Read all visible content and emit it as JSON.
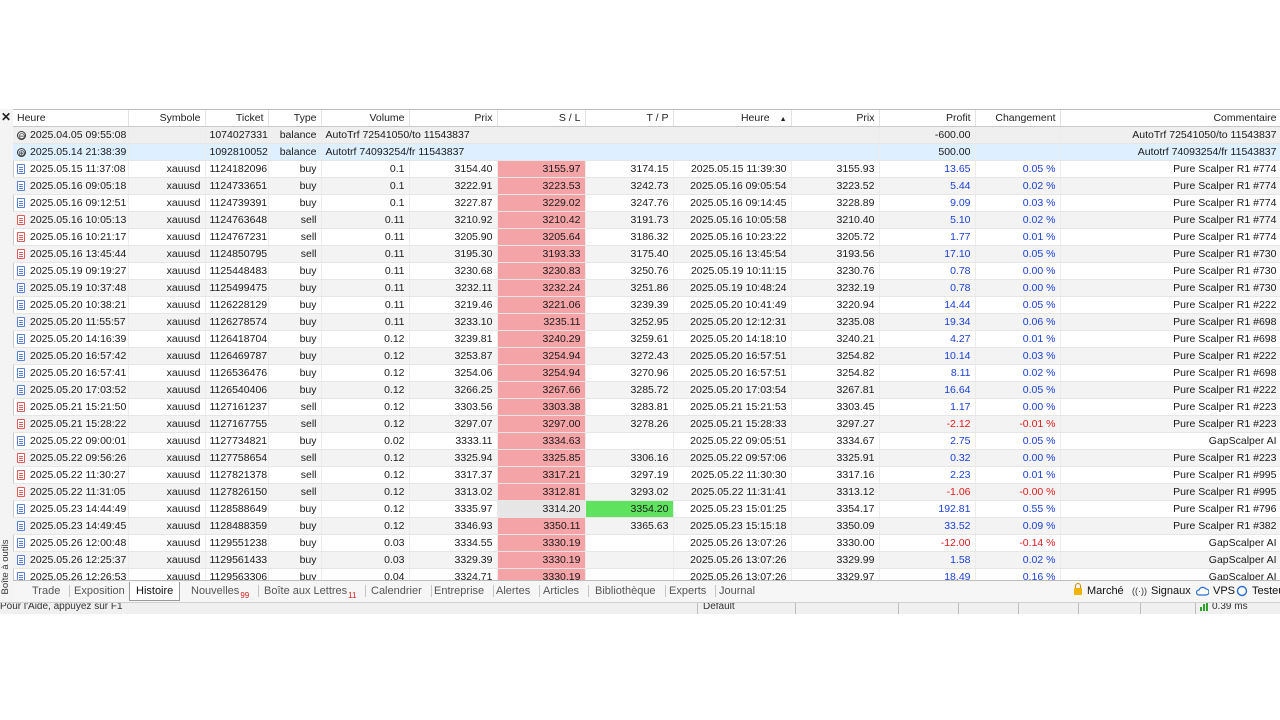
{
  "side_panel": {
    "close": "✕",
    "label": "Boîte à outils"
  },
  "columns": [
    "Heure",
    "Symbole",
    "Ticket",
    "Type",
    "Volume",
    "Prix",
    "S / L",
    "T / P",
    "Heure",
    "Prix",
    "Profit",
    "Changement",
    "Commentaire"
  ],
  "sort_indicator": "▲",
  "balance_rows": [
    {
      "time": "2025.04.05 09:55:08",
      "ticket": "1074027331",
      "type": "balance",
      "text": "AutoTrf 72541050/to 11543837",
      "profit": "-600.00",
      "comment": "AutoTrf 72541050/to 11543837",
      "sign": "⊖"
    },
    {
      "time": "2025.05.14 21:38:39",
      "ticket": "1092810052",
      "type": "balance",
      "text": "Autotrf 74093254/fr 11543837",
      "profit": "500.00",
      "comment": "Autotrf 74093254/fr 11543837",
      "sign": "⊕"
    }
  ],
  "trades": [
    {
      "t1": "2025.05.15 11:37:08",
      "sym": "xauusd",
      "ticket": "1124182096",
      "type": "buy",
      "vol": "0.1",
      "p1": "3154.40",
      "sl": "3155.97",
      "tp": "3174.15",
      "t2": "2025.05.15 11:39:30",
      "p2": "3155.93",
      "profit": "13.65",
      "chg": "0.05 %"
    },
    {
      "t1": "2025.05.16 09:05:18",
      "sym": "xauusd",
      "ticket": "1124733651",
      "type": "buy",
      "vol": "0.1",
      "p1": "3222.91",
      "sl": "3223.53",
      "tp": "3242.73",
      "t2": "2025.05.16 09:05:54",
      "p2": "3223.52",
      "profit": "5.44",
      "chg": "0.02 %"
    },
    {
      "t1": "2025.05.16 09:12:51",
      "sym": "xauusd",
      "ticket": "1124739391",
      "type": "buy",
      "vol": "0.1",
      "p1": "3227.87",
      "sl": "3229.02",
      "tp": "3247.76",
      "t2": "2025.05.16 09:14:45",
      "p2": "3228.89",
      "profit": "9.09",
      "chg": "0.03 %"
    },
    {
      "t1": "2025.05.16 10:05:13",
      "sym": "xauusd",
      "ticket": "1124763648",
      "type": "sell",
      "vol": "0.11",
      "p1": "3210.92",
      "sl": "3210.42",
      "tp": "3191.73",
      "t2": "2025.05.16 10:05:58",
      "p2": "3210.40",
      "profit": "5.10",
      "chg": "0.02 %"
    },
    {
      "t1": "2025.05.16 10:21:17",
      "sym": "xauusd",
      "ticket": "1124767231",
      "type": "sell",
      "vol": "0.11",
      "p1": "3205.90",
      "sl": "3205.64",
      "tp": "3186.32",
      "t2": "2025.05.16 10:23:22",
      "p2": "3205.72",
      "profit": "1.77",
      "chg": "0.01 %"
    },
    {
      "t1": "2025.05.16 13:45:44",
      "sym": "xauusd",
      "ticket": "1124850795",
      "type": "sell",
      "vol": "0.11",
      "p1": "3195.30",
      "sl": "3193.33",
      "tp": "3175.40",
      "t2": "2025.05.16 13:45:54",
      "p2": "3193.56",
      "profit": "17.10",
      "chg": "0.05 %"
    },
    {
      "t1": "2025.05.19 09:19:27",
      "sym": "xauusd",
      "ticket": "1125448483",
      "type": "buy",
      "vol": "0.11",
      "p1": "3230.68",
      "sl": "3230.83",
      "tp": "3250.76",
      "t2": "2025.05.19 10:11:15",
      "p2": "3230.76",
      "profit": "0.78",
      "chg": "0.00 %"
    },
    {
      "t1": "2025.05.19 10:37:48",
      "sym": "xauusd",
      "ticket": "1125499475",
      "type": "buy",
      "vol": "0.11",
      "p1": "3232.11",
      "sl": "3232.24",
      "tp": "3251.86",
      "t2": "2025.05.19 10:48:24",
      "p2": "3232.19",
      "profit": "0.78",
      "chg": "0.00 %"
    },
    {
      "t1": "2025.05.20 10:38:21",
      "sym": "xauusd",
      "ticket": "1126228129",
      "type": "buy",
      "vol": "0.11",
      "p1": "3219.46",
      "sl": "3221.06",
      "tp": "3239.39",
      "t2": "2025.05.20 10:41:49",
      "p2": "3220.94",
      "profit": "14.44",
      "chg": "0.05 %"
    },
    {
      "t1": "2025.05.20 11:55:57",
      "sym": "xauusd",
      "ticket": "1126278574",
      "type": "buy",
      "vol": "0.11",
      "p1": "3233.10",
      "sl": "3235.11",
      "tp": "3252.95",
      "t2": "2025.05.20 12:12:31",
      "p2": "3235.08",
      "profit": "19.34",
      "chg": "0.06 %"
    },
    {
      "t1": "2025.05.20 14:16:39",
      "sym": "xauusd",
      "ticket": "1126418704",
      "type": "buy",
      "vol": "0.12",
      "p1": "3239.81",
      "sl": "3240.29",
      "tp": "3259.61",
      "t2": "2025.05.20 14:18:10",
      "p2": "3240.21",
      "profit": "4.27",
      "chg": "0.01 %"
    },
    {
      "t1": "2025.05.20 16:57:42",
      "sym": "xauusd",
      "ticket": "1126469787",
      "type": "buy",
      "vol": "0.12",
      "p1": "3253.87",
      "sl": "3254.94",
      "tp": "3272.43",
      "t2": "2025.05.20 16:57:51",
      "p2": "3254.82",
      "profit": "10.14",
      "chg": "0.03 %"
    },
    {
      "t1": "2025.05.20 16:57:41",
      "sym": "xauusd",
      "ticket": "1126536476",
      "type": "buy",
      "vol": "0.12",
      "p1": "3254.06",
      "sl": "3254.94",
      "tp": "3270.96",
      "t2": "2025.05.20 16:57:51",
      "p2": "3254.82",
      "profit": "8.11",
      "chg": "0.02 %"
    },
    {
      "t1": "2025.05.20 17:03:52",
      "sym": "xauusd",
      "ticket": "1126540406",
      "type": "buy",
      "vol": "0.12",
      "p1": "3266.25",
      "sl": "3267.66",
      "tp": "3285.72",
      "t2": "2025.05.20 17:03:54",
      "p2": "3267.81",
      "profit": "16.64",
      "chg": "0.05 %"
    },
    {
      "t1": "2025.05.21 15:21:50",
      "sym": "xauusd",
      "ticket": "1127161237",
      "type": "sell",
      "vol": "0.12",
      "p1": "3303.56",
      "sl": "3303.38",
      "tp": "3283.81",
      "t2": "2025.05.21 15:21:53",
      "p2": "3303.45",
      "profit": "1.17",
      "chg": "0.00 %"
    },
    {
      "t1": "2025.05.21 15:28:22",
      "sym": "xauusd",
      "ticket": "1127167755",
      "type": "sell",
      "vol": "0.12",
      "p1": "3297.07",
      "sl": "3297.00",
      "tp": "3278.26",
      "t2": "2025.05.21 15:28:33",
      "p2": "3297.27",
      "profit": "-2.12",
      "chg": "-0.01 %"
    },
    {
      "t1": "2025.05.22 09:00:01",
      "sym": "xauusd",
      "ticket": "1127734821",
      "type": "buy",
      "vol": "0.02",
      "p1": "3333.11",
      "sl": "3334.63",
      "tp": "",
      "t2": "2025.05.22 09:05:51",
      "p2": "3334.67",
      "profit": "2.75",
      "chg": "0.05 %"
    },
    {
      "t1": "2025.05.22 09:56:26",
      "sym": "xauusd",
      "ticket": "1127758654",
      "type": "sell",
      "vol": "0.12",
      "p1": "3325.94",
      "sl": "3325.85",
      "tp": "3306.16",
      "t2": "2025.05.22 09:57:06",
      "p2": "3325.91",
      "profit": "0.32",
      "chg": "0.00 %"
    },
    {
      "t1": "2025.05.22 11:30:27",
      "sym": "xauusd",
      "ticket": "1127821378",
      "type": "sell",
      "vol": "0.12",
      "p1": "3317.37",
      "sl": "3317.21",
      "tp": "3297.19",
      "t2": "2025.05.22 11:30:30",
      "p2": "3317.16",
      "profit": "2.23",
      "chg": "0.01 %"
    },
    {
      "t1": "2025.05.22 11:31:05",
      "sym": "xauusd",
      "ticket": "1127826150",
      "type": "sell",
      "vol": "0.12",
      "p1": "3313.02",
      "sl": "3312.81",
      "tp": "3293.02",
      "t2": "2025.05.22 11:31:41",
      "p2": "3313.12",
      "profit": "-1.06",
      "chg": "-0.00 %"
    },
    {
      "t1": "2025.05.23 14:44:49",
      "sym": "xauusd",
      "ticket": "1128588649",
      "type": "buy",
      "vol": "0.12",
      "p1": "3335.97",
      "sl": "3314.20",
      "tp": "3354.20",
      "t2": "2025.05.23 15:01:25",
      "p2": "3354.17",
      "profit": "192.81",
      "chg": "0.55 %"
    },
    {
      "t1": "2025.05.23 14:49:45",
      "sym": "xauusd",
      "ticket": "1128488359",
      "type": "buy",
      "vol": "0.12",
      "p1": "3346.93",
      "sl": "3350.11",
      "tp": "3365.63",
      "t2": "2025.05.23 15:15:18",
      "p2": "3350.09",
      "profit": "33.52",
      "chg": "0.09 %"
    },
    {
      "t1": "2025.05.26 12:00:48",
      "sym": "xauusd",
      "ticket": "1129551238",
      "type": "buy",
      "vol": "0.03",
      "p1": "3334.55",
      "sl": "3330.19",
      "tp": "",
      "t2": "2025.05.26 13:07:26",
      "p2": "3330.00",
      "profit": "-12.00",
      "chg": "-0.14 %"
    },
    {
      "t1": "2025.05.26 12:25:37",
      "sym": "xauusd",
      "ticket": "1129561433",
      "type": "buy",
      "vol": "0.03",
      "p1": "3329.39",
      "sl": "3330.19",
      "tp": "",
      "t2": "2025.05.26 13:07:26",
      "p2": "3329.99",
      "profit": "1.58",
      "chg": "0.02 %"
    },
    {
      "t1": "2025.05.26 12:26:53",
      "sym": "xauusd",
      "ticket": "1129563306",
      "type": "buy",
      "vol": "0.04",
      "p1": "3324.71",
      "sl": "3330.19",
      "tp": "",
      "t2": "2025.05.26 13:07:26",
      "p2": "3329.97",
      "profit": "18.49",
      "chg": "0.16 %"
    }
  ],
  "comments": [
    "Pure Scalper R1 #774",
    "Pure Scalper R1 #774",
    "Pure Scalper R1 #774",
    "Pure Scalper R1 #774",
    "Pure Scalper R1 #774",
    "Pure Scalper R1 #730",
    "Pure Scalper R1 #730",
    "Pure Scalper R1 #730",
    "Pure Scalper R1 #222",
    "Pure Scalper R1 #698",
    "Pure Scalper R1 #698",
    "Pure Scalper R1 #222",
    "Pure Scalper R1 #698",
    "Pure Scalper R1 #222",
    "Pure Scalper R1 #223",
    "Pure Scalper R1 #223",
    "GapScalper AI",
    "Pure Scalper R1 #223",
    "Pure Scalper R1 #995",
    "Pure Scalper R1 #995",
    "Pure Scalper R1 #796",
    "Pure Scalper R1 #382",
    "GapScalper AI",
    "GapScalper AI",
    "GapScalper AI"
  ],
  "tabs": [
    {
      "label": "Trade",
      "badge": ""
    },
    {
      "label": "Exposition",
      "badge": ""
    },
    {
      "label": "Histoire",
      "badge": "",
      "active": true
    },
    {
      "label": "Nouvelles",
      "badge": "99"
    },
    {
      "label": "Boîte aux Lettres",
      "badge": "11"
    },
    {
      "label": "Calendrier",
      "badge": ""
    },
    {
      "label": "Entreprise",
      "badge": ""
    },
    {
      "label": "Alertes",
      "badge": ""
    },
    {
      "label": "Articles",
      "badge": ""
    },
    {
      "label": "Bibliothèque",
      "badge": ""
    },
    {
      "label": "Experts",
      "badge": ""
    },
    {
      "label": "Journal",
      "badge": ""
    }
  ],
  "right_tabs": [
    {
      "label": "Marché",
      "icon": "lock-icon"
    },
    {
      "label": "Signaux",
      "icon": "signal-icon"
    },
    {
      "label": "VPS",
      "icon": "cloud-icon"
    },
    {
      "label": "Testeu",
      "icon": "tester-icon"
    }
  ],
  "status": {
    "help": "Pour l'Aide, appuyez sur F1",
    "profile": "Default",
    "ping": "0.39 ms"
  }
}
